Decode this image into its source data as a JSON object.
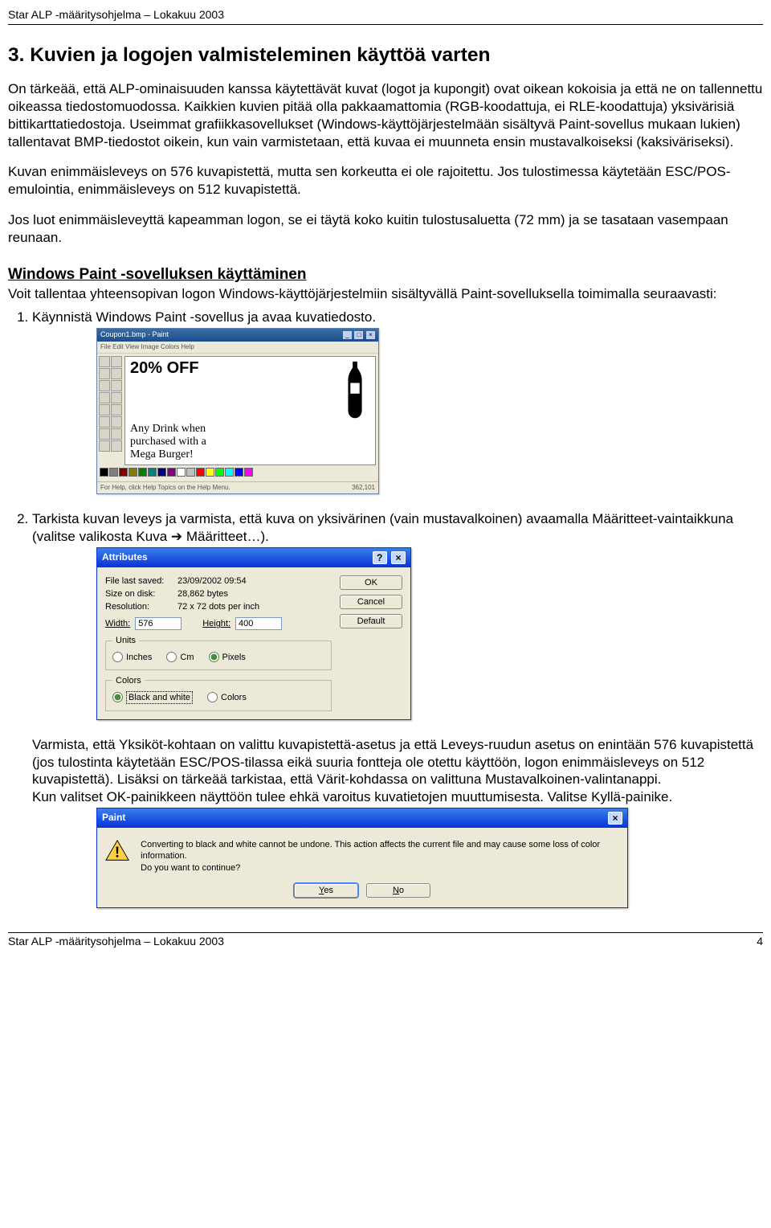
{
  "header": "Star ALP -määritysohjelma – Lokakuu 2003",
  "h1": "3. Kuvien ja logojen valmisteleminen käyttöä varten",
  "p1": "On tärkeää, että ALP-ominaisuuden kanssa käytettävät kuvat (logot ja kupongit) ovat oikean kokoisia ja että ne on tallennettu oikeassa tiedostomuodossa. Kaikkien kuvien pitää olla pakkaamattomia (RGB-koodattuja, ei RLE-koodattuja) yksivärisiä bittikarttatiedostoja. Useimmat grafiikkasovellukset (Windows-käyttöjärjestelmään sisältyvä Paint-sovellus mukaan lukien) tallentavat BMP-tiedostot oikein, kun vain varmistetaan, että kuvaa ei muunneta ensin mustavalkoiseksi (kaksiväriseksi).",
  "p2": "Kuvan enimmäisleveys on 576 kuvapistettä, mutta sen korkeutta ei ole rajoitettu. Jos tulostimessa käytetään ESC/POS-emulointia, enimmäisleveys on 512 kuvapistettä.",
  "p3": "Jos luot enimmäisleveyttä kapeamman logon, se ei täytä koko kuitin tulostusaluetta (72 mm) ja se tasataan vasempaan reunaan.",
  "sub": "Windows Paint -sovelluksen käyttäminen",
  "subp": "Voit tallentaa yhteensopivan logon Windows-käyttöjärjestelmiin sisältyvällä Paint-sovelluksella toimimalla seuraavasti:",
  "step1": "Käynnistä Windows Paint -sovellus ja avaa kuvatiedosto.",
  "step2": "Tarkista kuvan leveys ja varmista, että kuva on yksivärinen (vain mustavalkoinen) avaamalla Määritteet-vaintaikkuna (valitse valikosta Kuva ➔ Määritteet…).",
  "step2_cont": "Varmista, että Yksiköt-kohtaan on valittu kuvapistettä-asetus ja että Leveys-ruudun asetus on enintään 576 kuvapistettä (jos tulostinta käytetään ESC/POS-tilassa eikä suuria fontteja ole otettu käyttöön, logon enimmäisleveys on 512 kuvapistettä). Lisäksi on tärkeää tarkistaa, että Värit-kohdassa on valittuna Mustavalkoinen-valintanappi.",
  "step2_cont2": "Kun valitset OK-painikkeen näyttöön tulee ehkä varoitus kuvatietojen muuttumisesta. Valitse Kyllä-painike.",
  "paint": {
    "title": "Coupon1.bmp - Paint",
    "menu": "File  Edit  View  Image  Colors  Help",
    "big": "20% OFF",
    "l1": "Any Drink when",
    "l2": "purchased with a",
    "l3": "Mega Burger!",
    "status_left": "For Help, click Help Topics on the Help Menu.",
    "status_right": "362,101"
  },
  "attr": {
    "title": "Attributes",
    "file_last_saved_label": "File last saved:",
    "file_last_saved": "23/09/2002 09:54",
    "size_label": "Size on disk:",
    "size": "28,862 bytes",
    "res_label": "Resolution:",
    "res": "72 x 72 dots per inch",
    "width_label": "Width:",
    "width": "576",
    "height_label": "Height:",
    "height": "400",
    "units_legend": "Units",
    "u_inches": "Inches",
    "u_cm": "Cm",
    "u_pixels": "Pixels",
    "colors_legend": "Colors",
    "c_bw": "Black and white",
    "c_colors": "Colors",
    "ok": "OK",
    "cancel": "Cancel",
    "default": "Default"
  },
  "warn": {
    "title": "Paint",
    "text1": "Converting to black and white cannot be undone. This action affects the current file and may cause some loss of color information.",
    "text2": "Do you want to continue?",
    "yes": "Yes",
    "no": "No"
  },
  "footer_left": "Star ALP -määritysohjelma – Lokakuu 2003",
  "footer_right": "4"
}
